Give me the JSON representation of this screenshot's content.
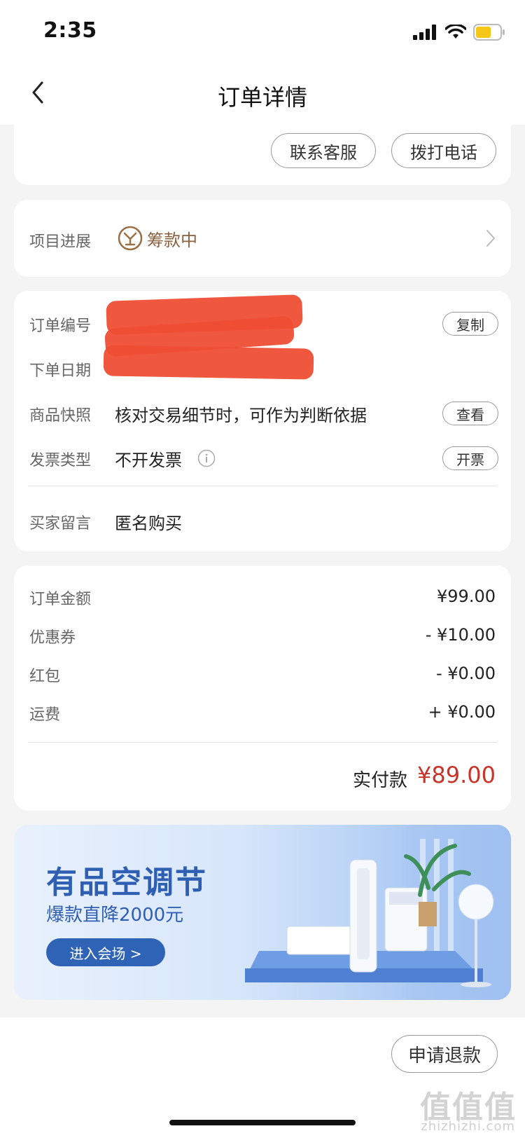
{
  "status": {
    "time": "2:35"
  },
  "nav": {
    "title": "订单详情"
  },
  "contact": {
    "service_label": "联系客服",
    "call_label": "拨打电话"
  },
  "progress": {
    "label": "项目进展",
    "status": "筹款中"
  },
  "order": {
    "number_label": "订单编号",
    "date_label": "下单日期",
    "copy_label": "复制",
    "snapshot_label": "商品快照",
    "snapshot_value": "核对交易细节时，可作为判断依据",
    "view_label": "查看",
    "invoice_label": "发票类型",
    "invoice_value": "不开发票",
    "invoice_btn": "开票",
    "note_label": "买家留言",
    "note_value": "匿名购买"
  },
  "amounts": {
    "rows": [
      {
        "label": "订单金额",
        "value": "¥99.00"
      },
      {
        "label": "优惠券",
        "value": "- ¥10.00"
      },
      {
        "label": "红包",
        "value": "- ¥0.00"
      },
      {
        "label": "运费",
        "value": "+ ¥0.00"
      }
    ],
    "paid_label": "实付款",
    "paid_value": "¥89.00",
    "paid_color": "#c8342a"
  },
  "banner": {
    "title": "有品空调节",
    "subtitle": "爆款直降2000元",
    "button": "进入会场 >"
  },
  "footer": {
    "refund_label": "申请退款"
  },
  "watermark": {
    "brand": "值值值",
    "url": "zhizhizhi.com"
  }
}
